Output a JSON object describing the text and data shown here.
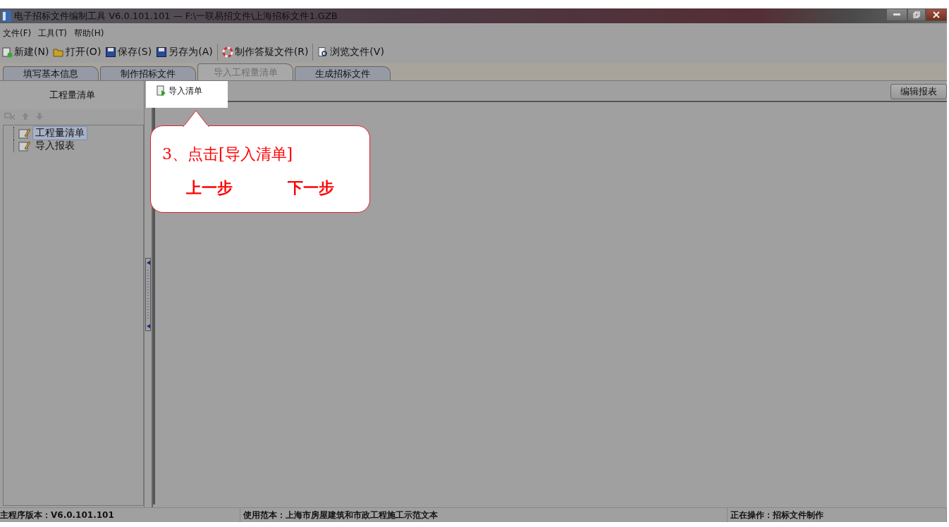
{
  "window": {
    "title": "电子招标文件编制工具 V6.0.101.101 — F:\\一联易招文件\\上海招标文件1.GZB"
  },
  "menu": [
    {
      "label": "文件(F)"
    },
    {
      "label": "工具(T)"
    },
    {
      "label": "帮助(H)"
    }
  ],
  "toolbar": [
    [
      {
        "kind": "new",
        "label": "新建(N)"
      },
      {
        "kind": "open",
        "label": "打开(O)"
      },
      {
        "kind": "save",
        "label": "保存(S)"
      },
      {
        "kind": "save",
        "label": "另存为(A)"
      }
    ],
    [
      {
        "kind": "lifebuoy",
        "label": "制作答疑文件(R)"
      }
    ],
    [
      {
        "kind": "browse",
        "label": "浏览文件(V)"
      }
    ]
  ],
  "tabs": [
    {
      "label": "填写基本信息",
      "selected": false
    },
    {
      "label": "制作招标文件",
      "selected": false
    },
    {
      "label": "导入工程量清单",
      "selected": true
    },
    {
      "label": "生成招标文件",
      "selected": false
    }
  ],
  "left_panel": {
    "title": "工程量清单",
    "tree": [
      {
        "label": "工程量清单",
        "selected": true
      },
      {
        "label": "导入报表",
        "selected": false
      }
    ]
  },
  "import_button": {
    "label": "导入清单"
  },
  "edit_report_button": {
    "label": "编辑报表"
  },
  "callout": {
    "title": "3、点击[导入清单]",
    "prev": "上一步",
    "next": "下一步"
  },
  "status_bar": [
    "主程序版本：V6.0.101.101",
    "使用范本：上海市房屋建筑和市政工程施工示范文本",
    "正在操作：招标文件制作"
  ]
}
